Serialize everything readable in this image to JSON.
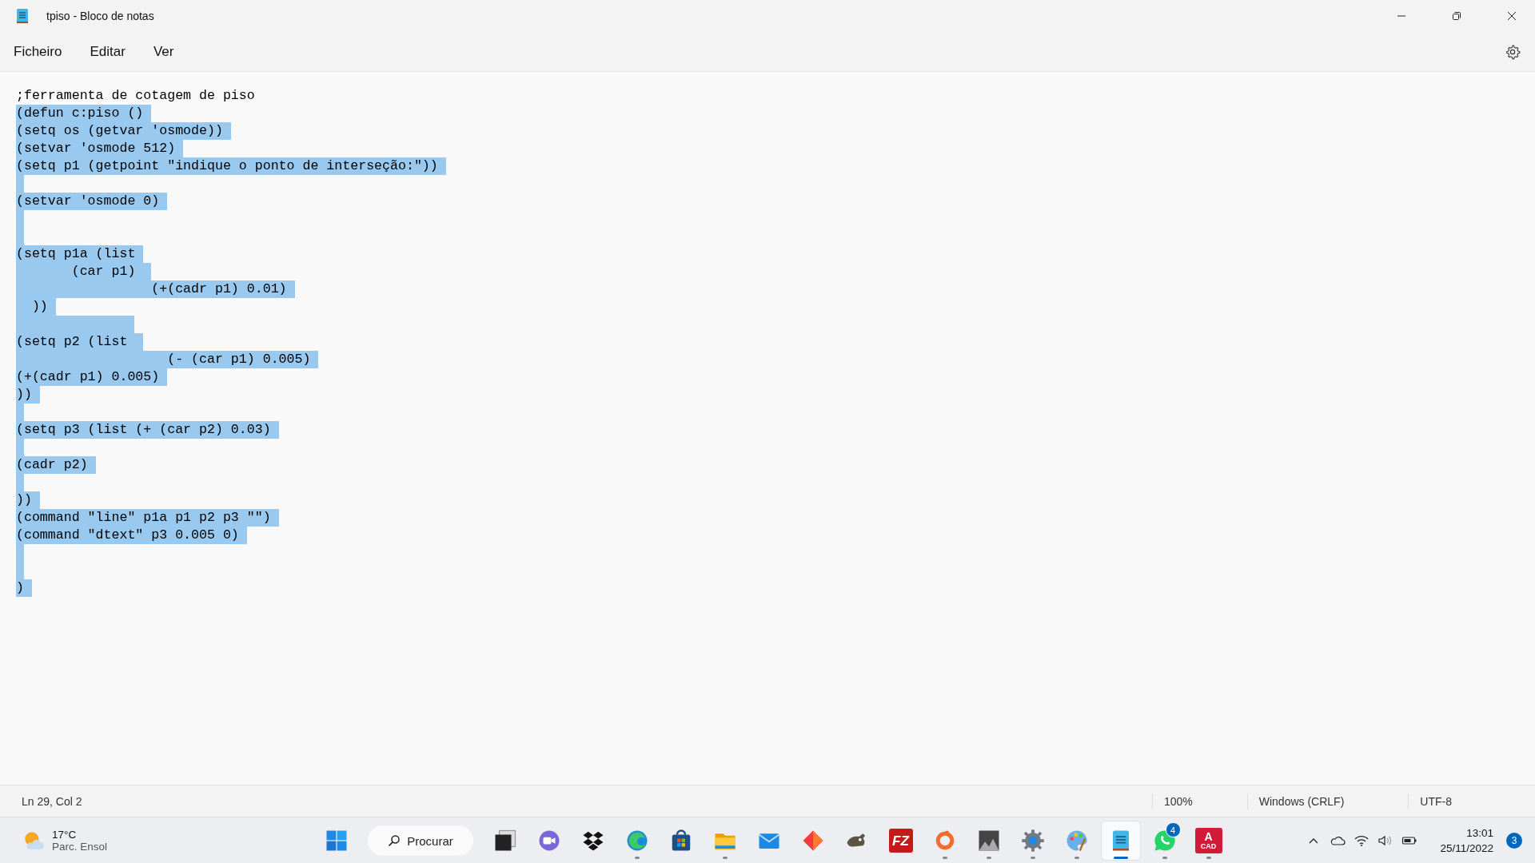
{
  "window": {
    "title": "tpiso - Bloco de notas"
  },
  "menu": [
    "Ficheiro",
    "Editar",
    "Ver"
  ],
  "editor": {
    "lines": [
      {
        "text": ";ferramenta de cotagem de piso",
        "selected": false
      },
      {
        "text": "(defun c:piso ()",
        "selected": true
      },
      {
        "text": "(setq os (getvar 'osmode))",
        "selected": true
      },
      {
        "text": "(setvar 'osmode 512)",
        "selected": true
      },
      {
        "text": "(setq p1 (getpoint \"indique o ponto de interseção:\"))",
        "selected": true
      },
      {
        "selected": true
      },
      {
        "text": "(setvar 'osmode 0)",
        "selected": true
      },
      {
        "selected": true
      },
      {
        "selected": true
      },
      {
        "text": "(setq p1a (list",
        "selected": true
      },
      {
        "text": "       (car p1) ",
        "selected": true
      },
      {
        "text": "                 (+(cadr p1) 0.01)",
        "selected": true
      },
      {
        "text": "  ))",
        "selected": true
      },
      {
        "selected": true,
        "wide": true
      },
      {
        "text": "(setq p2 (list ",
        "selected": true
      },
      {
        "text": "                   (- (car p1) 0.005)",
        "selected": true
      },
      {
        "text": "(+(cadr p1) 0.005)",
        "selected": true
      },
      {
        "text": "))",
        "selected": true
      },
      {
        "selected": true
      },
      {
        "text": "(setq p3 (list (+ (car p2) 0.03)",
        "selected": true
      },
      {
        "selected": true
      },
      {
        "text": "(cadr p2)",
        "selected": true
      },
      {
        "selected": true
      },
      {
        "text": "))",
        "selected": true
      },
      {
        "text": "(command \"line\" p1a p1 p2 p3 \"\")",
        "selected": true
      },
      {
        "text": "(command \"dtext\" p3 0.005 0)",
        "selected": true
      },
      {
        "selected": true
      },
      {
        "selected": true
      },
      {
        "text": ")",
        "selected": true
      }
    ]
  },
  "status_bar": {
    "position": "Ln 29, Col 2",
    "zoom": "100%",
    "line_ending": "Windows (CRLF)",
    "encoding": "UTF-8"
  },
  "taskbar": {
    "weather": {
      "temperature": "17°C",
      "condition": "Parc. Ensol"
    },
    "apps": [
      {
        "kind": "start"
      },
      {
        "kind": "search",
        "label": "Procurar"
      },
      {
        "kind": "app",
        "running": false,
        "selected": false
      },
      {
        "kind": "app",
        "running": false,
        "selected": false
      },
      {
        "kind": "app",
        "running": false,
        "selected": false
      },
      {
        "kind": "app",
        "running": true,
        "selected": false
      },
      {
        "kind": "app",
        "running": false,
        "selected": false
      },
      {
        "kind": "app",
        "running": true,
        "selected": false
      },
      {
        "kind": "app",
        "running": false,
        "selected": false
      },
      {
        "kind": "app",
        "running": false,
        "selected": false
      },
      {
        "kind": "app",
        "running": false,
        "selected": false
      },
      {
        "kind": "app",
        "running": false,
        "selected": false,
        "icon_text": "FZ"
      },
      {
        "kind": "app",
        "running": true,
        "selected": false
      },
      {
        "kind": "app",
        "running": true,
        "selected": false
      },
      {
        "kind": "app",
        "running": true,
        "selected": false
      },
      {
        "kind": "app",
        "running": true,
        "selected": false
      },
      {
        "kind": "app",
        "running": true,
        "selected": true
      },
      {
        "kind": "app",
        "running": true,
        "selected": false,
        "badge": "4"
      },
      {
        "kind": "app",
        "running": true,
        "selected": false,
        "icon_text": "A",
        "icon_subtext": "CAD"
      }
    ],
    "time": "13:01",
    "date": "25/11/2022",
    "notifications": "3"
  }
}
